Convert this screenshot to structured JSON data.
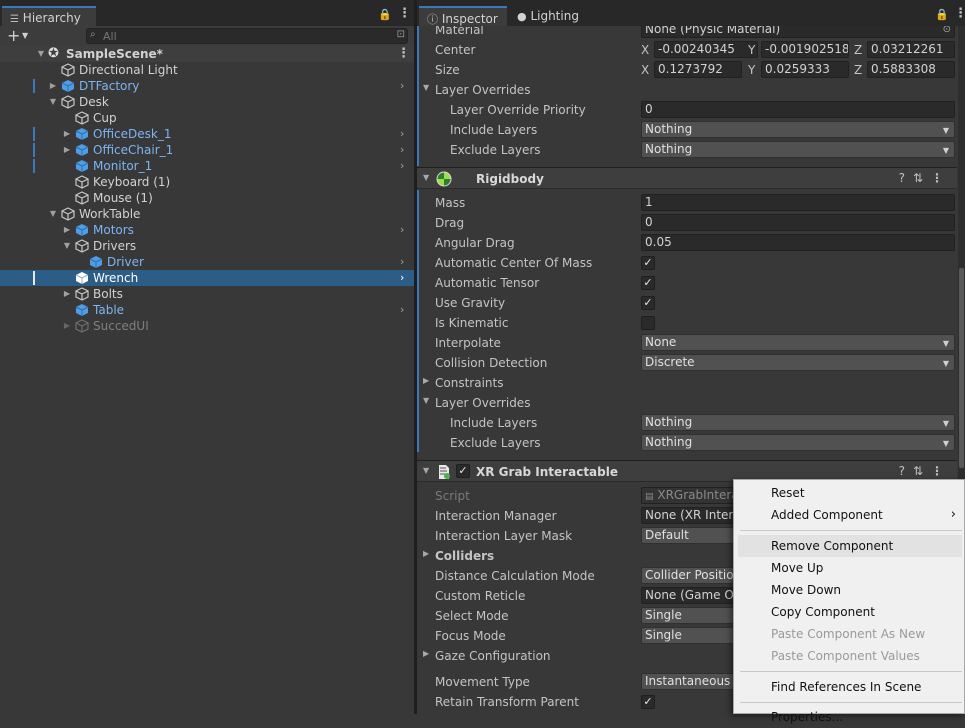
{
  "hierarchy": {
    "tab_label": "Hierarchy",
    "search_placeholder": "All",
    "scene_name": "SampleScene*",
    "items": [
      {
        "label": "Directional Light"
      },
      {
        "label": "DTFactory"
      },
      {
        "label": "Desk"
      },
      {
        "label": "Cup"
      },
      {
        "label": "OfficeDesk_1"
      },
      {
        "label": "OfficeChair_1"
      },
      {
        "label": "Monitor_1"
      },
      {
        "label": "Keyboard (1)"
      },
      {
        "label": "Mouse (1)"
      },
      {
        "label": "WorkTable"
      },
      {
        "label": "Motors"
      },
      {
        "label": "Drivers"
      },
      {
        "label": "Driver"
      },
      {
        "label": "Wrench"
      },
      {
        "label": "Bolts"
      },
      {
        "label": "Table"
      },
      {
        "label": "SuccedUI"
      }
    ]
  },
  "inspector": {
    "tabs": [
      {
        "label": "Inspector"
      },
      {
        "label": "Lighting"
      }
    ],
    "collider": {
      "material_label": "Material",
      "material_value": "None (Physic Material)",
      "center_label": "Center",
      "center": {
        "x": "-0.00240345",
        "y": "-0.001902518",
        "z": "0.03212261"
      },
      "size_label": "Size",
      "size": {
        "x": "0.1273792",
        "y": "0.0259333",
        "z": "0.5883308"
      },
      "axis": {
        "x": "X",
        "y": "Y",
        "z": "Z"
      },
      "layer_overrides_label": "Layer Overrides",
      "priority_label": "Layer Override Priority",
      "priority_value": "0",
      "include_label": "Include Layers",
      "include_value": "Nothing",
      "exclude_label": "Exclude Layers",
      "exclude_value": "Nothing"
    },
    "rigidbody": {
      "title": "Rigidbody",
      "mass_label": "Mass",
      "mass": "1",
      "drag_label": "Drag",
      "drag": "0",
      "angular_drag_label": "Angular Drag",
      "angular_drag": "0.05",
      "auto_com_label": "Automatic Center Of Mass",
      "auto_com": true,
      "auto_tensor_label": "Automatic Tensor",
      "auto_tensor": true,
      "use_gravity_label": "Use Gravity",
      "use_gravity": true,
      "is_kinematic_label": "Is Kinematic",
      "is_kinematic": false,
      "interpolate_label": "Interpolate",
      "interpolate": "None",
      "collision_label": "Collision Detection",
      "collision": "Discrete",
      "constraints_label": "Constraints",
      "layer_overrides_label": "Layer Overrides",
      "include_label": "Include Layers",
      "include_value": "Nothing",
      "exclude_label": "Exclude Layers",
      "exclude_value": "Nothing"
    },
    "xr_grab": {
      "title": "XR Grab Interactable",
      "script_label": "Script",
      "script_value": "XRGrabInterac",
      "manager_label": "Interaction Manager",
      "manager_value": "None (XR Interac",
      "layer_mask_label": "Interaction Layer Mask",
      "layer_mask_value": "Default",
      "colliders_label": "Colliders",
      "distance_label": "Distance Calculation Mode",
      "distance_value": "Collider Position",
      "reticle_label": "Custom Reticle",
      "reticle_value": "None (Game Obj",
      "select_label": "Select Mode",
      "select_value": "Single",
      "focus_label": "Focus Mode",
      "focus_value": "Single",
      "gaze_label": "Gaze Configuration",
      "movement_label": "Movement Type",
      "movement_value": "Instantaneous",
      "retain_label": "Retain Transform Parent",
      "retain_value": true
    }
  },
  "context_menu": {
    "items": [
      {
        "label": "Reset",
        "enabled": true
      },
      {
        "label": "Added Component",
        "enabled": true,
        "submenu": true
      },
      {
        "label": "Remove Component",
        "enabled": true,
        "highlighted": true
      },
      {
        "label": "Move Up",
        "enabled": true
      },
      {
        "label": "Move Down",
        "enabled": true
      },
      {
        "label": "Copy Component",
        "enabled": true
      },
      {
        "label": "Paste Component As New",
        "enabled": false
      },
      {
        "label": "Paste Component Values",
        "enabled": false
      },
      {
        "label": "Find References In Scene",
        "enabled": true
      },
      {
        "label": "Properties...",
        "enabled": true
      }
    ]
  },
  "colors": {
    "accent": "#3a79bb",
    "prefab_text": "#7cb5f2",
    "selection": "#2c5d87",
    "panel_bg": "#383838"
  }
}
